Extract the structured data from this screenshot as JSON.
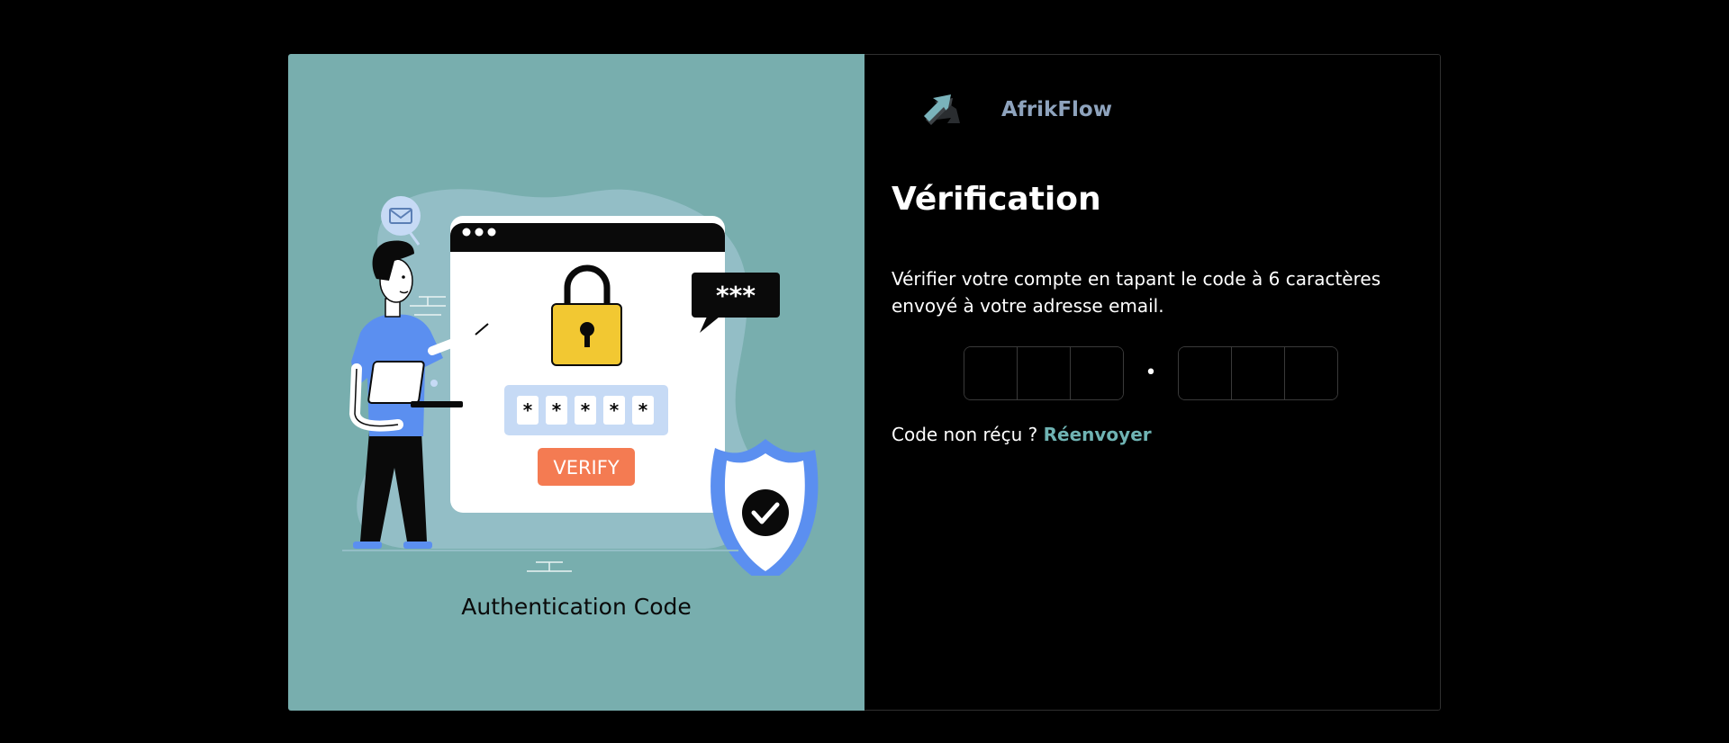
{
  "illustration": {
    "caption": "Authentication Code",
    "verify_label": "VERIFY",
    "bubble_text": "***",
    "password_chars": [
      "*",
      "*",
      "*",
      "*",
      "*"
    ]
  },
  "brand": {
    "name": "AfrikFlow",
    "logo_icon": "arrow-logo-icon"
  },
  "verification": {
    "title": "Vérification",
    "description": "Vérifier votre compte en tapant le code à 6 caractères envoyé à votre adresse email.",
    "separator": "•",
    "code_values": [
      "",
      "",
      "",
      "",
      "",
      ""
    ],
    "resend_prompt": "Code non réçu ?",
    "resend_link": "Réenvoyer"
  },
  "colors": {
    "left_panel_bg": "#78aeae",
    "accent": "#6fb3b3",
    "brand_text": "#8ea3bd",
    "verify_button": "#f47b52",
    "shield": "#5b8ff0",
    "lock": "#f2c832"
  }
}
